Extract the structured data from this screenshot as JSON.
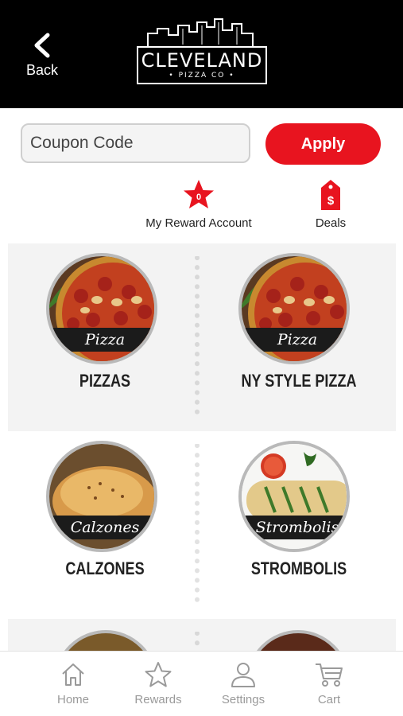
{
  "header": {
    "back_label": "Back",
    "logo": {
      "name": "CLEVELAND",
      "sub": "• PIZZA CO •"
    }
  },
  "coupon": {
    "placeholder": "Coupon Code",
    "apply_label": "Apply"
  },
  "shortcuts": {
    "reward": {
      "badge": "0",
      "label": "My Reward Account"
    },
    "deals": {
      "label": "Deals"
    }
  },
  "categories": [
    {
      "label": "PIZZAS",
      "banner": "Pizza"
    },
    {
      "label": "NY STYLE PIZZA",
      "banner": "Pizza"
    },
    {
      "label": "CALZONES",
      "banner": "Calzones"
    },
    {
      "label": "STROMBOLIS",
      "banner": "Strombolis"
    }
  ],
  "tabbar": {
    "items": [
      {
        "label": "Home",
        "icon": "home-icon"
      },
      {
        "label": "Rewards",
        "icon": "star-icon"
      },
      {
        "label": "Settings",
        "icon": "person-icon"
      },
      {
        "label": "Cart",
        "icon": "cart-icon"
      }
    ]
  },
  "colors": {
    "accent": "#e8141f",
    "header": "#000000",
    "section_gray": "#f3f3f3"
  }
}
